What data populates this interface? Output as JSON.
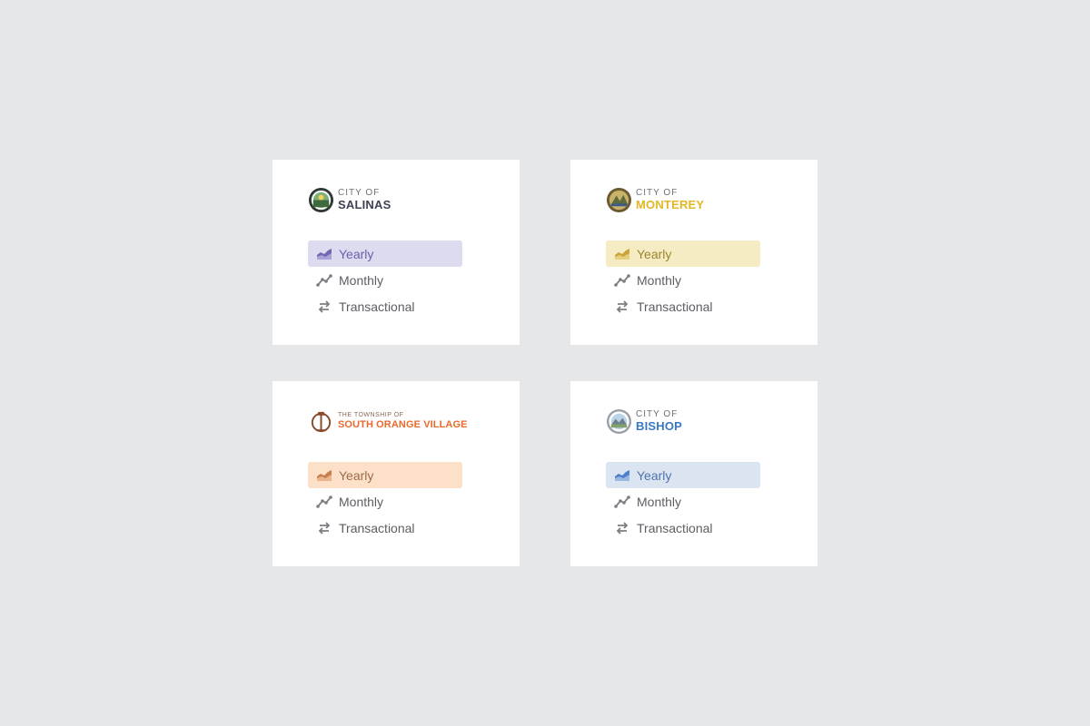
{
  "cards": [
    {
      "brand": {
        "prefix": "CITY OF",
        "name": "SALINAS",
        "color": "#3e4154"
      },
      "accent": {
        "bg": "#dddbef",
        "fg": "#6860a9",
        "icon": "#6e68b4"
      },
      "menu": [
        "Yearly",
        "Monthly",
        "Transactional"
      ]
    },
    {
      "brand": {
        "prefix": "CITY OF",
        "name": "MONTEREY",
        "color": "#e2b824"
      },
      "accent": {
        "bg": "#f5ecc3",
        "fg": "#9b8430",
        "icon": "#c9a43a"
      },
      "menu": [
        "Yearly",
        "Monthly",
        "Transactional"
      ]
    },
    {
      "brand": {
        "prefix": "THE TOWNSHIP OF",
        "name": "SOUTH ORANGE VILLAGE",
        "color": "#e96a2b"
      },
      "accent": {
        "bg": "#fde0c8",
        "fg": "#9c6a4a",
        "icon": "#c77f4e"
      },
      "menu": [
        "Yearly",
        "Monthly",
        "Transactional"
      ]
    },
    {
      "brand": {
        "prefix": "CITY OF",
        "name": "BISHOP",
        "color": "#3a77c2"
      },
      "accent": {
        "bg": "#dbe5f2",
        "fg": "#4f73ad",
        "icon": "#4f7fc7"
      },
      "menu": [
        "Yearly",
        "Monthly",
        "Transactional"
      ]
    }
  ],
  "icons": {
    "yearly": "area-chart-icon",
    "monthly": "line-chart-icon",
    "transactional": "swap-arrows-icon"
  },
  "neutral_icon_color": "#7d7d83"
}
